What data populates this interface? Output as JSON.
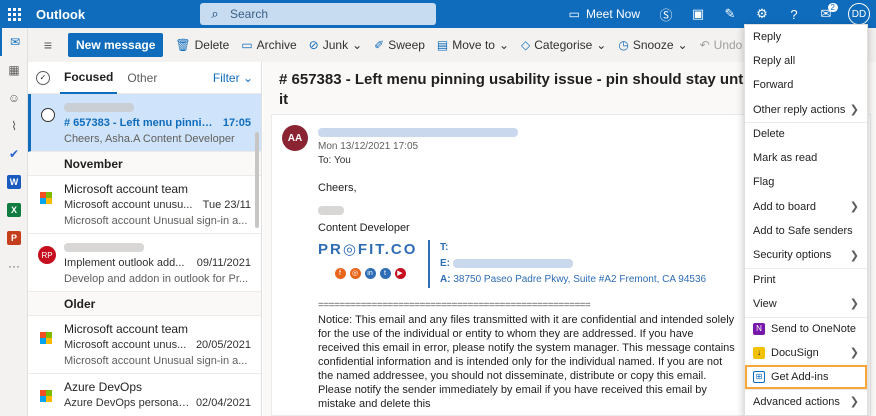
{
  "topbar": {
    "app_name": "Outlook",
    "search_placeholder": "Search",
    "meet_now": "Meet Now",
    "notif_count": "2",
    "avatar_initials": "DD"
  },
  "toolbar": {
    "new_message": "New message",
    "delete": "Delete",
    "archive": "Archive",
    "junk": "Junk",
    "sweep": "Sweep",
    "move_to": "Move to",
    "categorise": "Categorise",
    "snooze": "Snooze",
    "undo": "Undo",
    "more": "···"
  },
  "list": {
    "tab_focused": "Focused",
    "tab_other": "Other",
    "filter": "Filter",
    "groups": {
      "november": "November",
      "older": "Older"
    },
    "messages": [
      {
        "subject": "# 657383 - Left menu pinnin...",
        "date": "17:05",
        "preview": "Cheers, Asha.A Content Developer"
      },
      {
        "sender": "Microsoft account team",
        "subject": "Microsoft account unusu...",
        "date": "Tue 23/11",
        "preview": "Microsoft account Unusual sign-in a..."
      },
      {
        "avatar": "RP",
        "subject": "Implement outlook add...",
        "date": "09/11/2021",
        "preview": "Develop and addon in outlook for Pr..."
      },
      {
        "sender": "Microsoft account team",
        "subject": "Microsoft account unus...",
        "date": "20/05/2021",
        "preview": "Microsoft account Unusual sign-in a..."
      },
      {
        "sender": "Azure DevOps",
        "subject": "Azure DevOps personal ...",
        "date": "02/04/2021",
        "preview": ""
      }
    ]
  },
  "reading": {
    "subject": "# 657383 - Left menu pinning usability issue - pin should stay until the user clicks it",
    "avatar": "AA",
    "when": "Mon 13/12/2021 17:05",
    "to": "To:  You",
    "greeting": "Cheers,",
    "role": "Content Developer",
    "logo": "PR◎FIT.CO",
    "sig_t": "T:",
    "sig_e": "E:",
    "sig_a_label": "A:",
    "sig_a": "38750 Paseo Padre Pkwy, Suite #A2 Fremont, CA 94536",
    "separator": "===================================================",
    "notice": "Notice: This email and any files transmitted with it are confidential and intended solely for the use of the individual or entity to whom they are addressed. If you have received this email in error, please notify the system manager. This message contains confidential information and is intended only for the individual named. If you are not the named addressee, you should not disseminate, distribute or copy this email. Please notify the sender immediately by email if you have received this email by mistake and delete this"
  },
  "menu": {
    "items": [
      "Reply",
      "Reply all",
      "Forward",
      "Other reply actions",
      "Delete",
      "Mark as read",
      "Flag",
      "Add to board",
      "Add to Safe senders",
      "Security options",
      "Print",
      "View",
      "Send to OneNote",
      "DocuSign",
      "Get Add-ins",
      "Advanced actions"
    ]
  },
  "colors": {
    "brand": "#0f6cbd",
    "highlight": "#f7a738"
  }
}
